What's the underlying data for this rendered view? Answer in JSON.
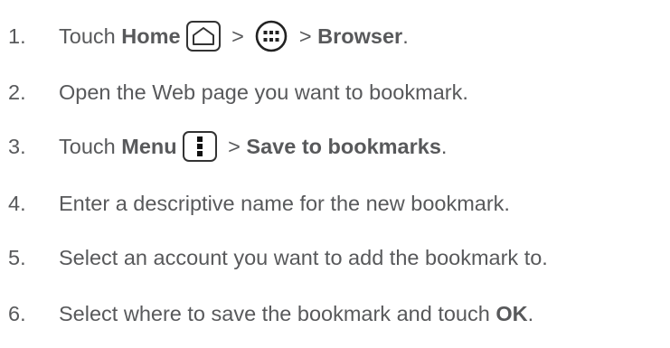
{
  "steps": [
    {
      "number": "1.",
      "parts": {
        "t1": "Touch ",
        "b1": "Home",
        "sep1": " > ",
        "sep2": " > ",
        "b2": "Browser",
        "end": "."
      },
      "icons": [
        "home-key-icon",
        "apps-grid-icon"
      ]
    },
    {
      "number": "2.",
      "text": "Open the Web page you want to bookmark."
    },
    {
      "number": "3.",
      "parts": {
        "t1": "Touch ",
        "b1": "Menu",
        "sep1": " > ",
        "b2": "Save to bookmarks",
        "end": "."
      },
      "icons": [
        "menu-key-icon"
      ]
    },
    {
      "number": "4.",
      "text": "Enter a descriptive name for the new bookmark."
    },
    {
      "number": "5.",
      "text": "Select an account you want to add the bookmark to."
    },
    {
      "number": "6.",
      "parts": {
        "t1": "Select where to save the bookmark and touch ",
        "b1": "OK",
        "end": "."
      }
    }
  ]
}
